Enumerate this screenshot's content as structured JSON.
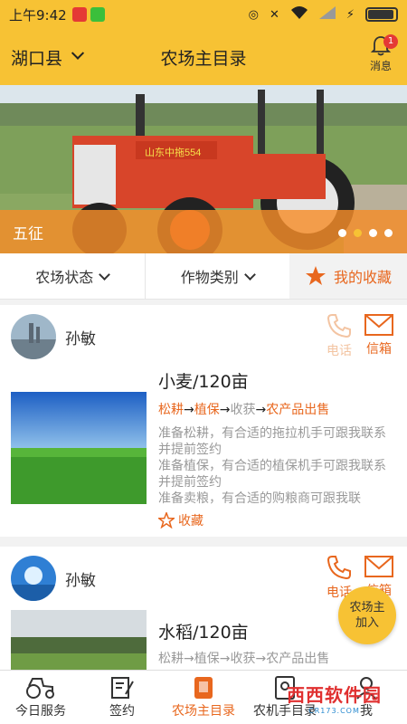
{
  "status_bar": {
    "time": "上午9:42",
    "network": "4G"
  },
  "header": {
    "region": "湖口县",
    "title": "农场主目录",
    "messages_label": "消息",
    "messages_badge": "1"
  },
  "banner": {
    "caption": "五征",
    "tractor_brand": "山东中拖554",
    "slides": 4,
    "active_slide": 2
  },
  "filters": {
    "farm_status": "农场状态",
    "crop_type": "作物类别",
    "favorites": "我的收藏"
  },
  "cards": [
    {
      "user": "孙敏",
      "phone_label": "电话",
      "mail_label": "信箱",
      "crop": "小麦/120亩",
      "steps": [
        "松耕",
        "植保",
        "收获",
        "农产品出售"
      ],
      "notes": [
        "准备松耕，有合适的拖拉机手可跟我联系并提前签约",
        "准备植保，有合适的植保机手可跟我联系并提前签约",
        "准备卖粮，有合适的购粮商可跟我联"
      ],
      "favorite_label": "收藏"
    },
    {
      "user": "孙敏",
      "phone_label": "电话",
      "mail_label": "信箱",
      "crop": "水稻/120亩",
      "steps": [
        "松耕",
        "植保",
        "收获",
        "农产品出售"
      ]
    }
  ],
  "join_button": {
    "line1": "农场主",
    "line2": "加入"
  },
  "bottom_nav": [
    {
      "label": "今日服务",
      "icon": "tractor-icon"
    },
    {
      "label": "签约",
      "icon": "contract-icon"
    },
    {
      "label": "农场主目录",
      "icon": "farmer-icon",
      "active": true
    },
    {
      "label": "农机手目录",
      "icon": "operator-icon"
    },
    {
      "label": "我",
      "icon": "user-icon"
    }
  ],
  "watermark": {
    "brand": "西西软件园",
    "url": "CR173.COM"
  },
  "colors": {
    "header": "#f7c234",
    "accent": "#e8671e"
  }
}
